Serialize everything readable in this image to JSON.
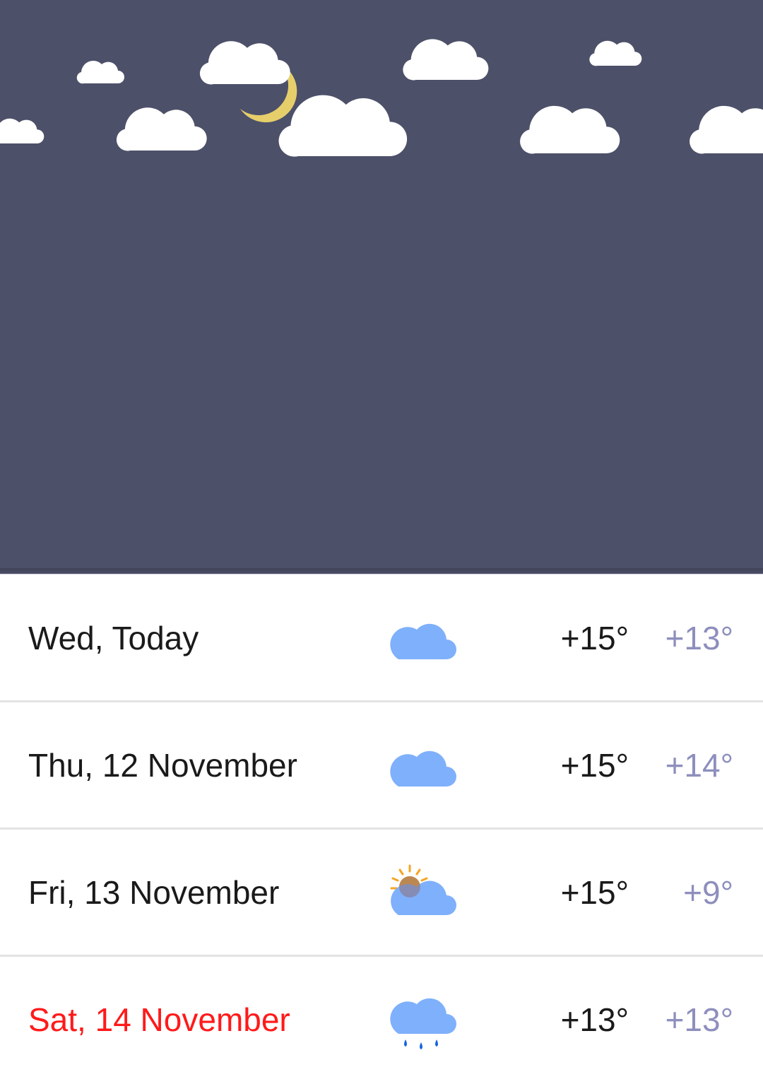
{
  "forecast": [
    {
      "day": "Wed, Today",
      "icon": "cloud-icon",
      "high": "+15°",
      "low": "+13°",
      "weekend": false
    },
    {
      "day": "Thu, 12 November",
      "icon": "cloud-icon",
      "high": "+15°",
      "low": "+14°",
      "weekend": false
    },
    {
      "day": "Fri, 13 November",
      "icon": "partly-sunny-icon",
      "high": "+15°",
      "low": "+9°",
      "weekend": false
    },
    {
      "day": "Sat, 14 November",
      "icon": "rain-cloud-icon",
      "high": "+13°",
      "low": "+13°",
      "weekend": true
    }
  ],
  "colors": {
    "sky": "#4d5069",
    "cloud_icon": "#7fb0fb",
    "low_temp": "#8e8fbd",
    "weekend": "#ff1a1a",
    "moon": "#e6cf6b"
  }
}
